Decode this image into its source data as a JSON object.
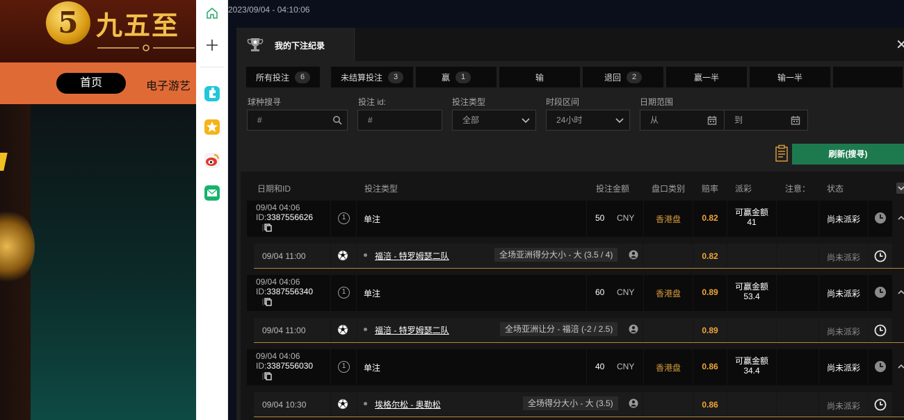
{
  "background_site": {
    "logo_glyph": "5",
    "logo_text": "九五至",
    "nav_home": "首页",
    "nav_games": "电子游艺"
  },
  "window": {
    "timestamp": "2023/09/04 - 04:10:06"
  },
  "modal": {
    "title": "我的下注纪录",
    "close_glyph": "✕",
    "tabs": [
      {
        "label": "所有投注",
        "count": "6"
      },
      {
        "label": "未结算投注",
        "count": "3"
      },
      {
        "label": "赢",
        "count": "1"
      },
      {
        "label": "输",
        "count": ""
      },
      {
        "label": "退回",
        "count": "2"
      },
      {
        "label": "赢一半",
        "count": ""
      },
      {
        "label": "输一半",
        "count": ""
      }
    ],
    "filters": {
      "sport_search": {
        "label": "球种搜寻",
        "placeholder": "#"
      },
      "bet_id": {
        "label": "投注 id:",
        "placeholder": "#"
      },
      "bet_type": {
        "label": "投注类型",
        "value": "全部"
      },
      "time_range": {
        "label": "时段区间",
        "value": "24小时"
      },
      "date_range": {
        "label": "日期范围",
        "from": "从",
        "to": "到"
      }
    },
    "refresh_label": "刷新(搜寻)",
    "columns": {
      "date_id": "日期和ID",
      "bet_type": "投注类型",
      "amount": "投注金额",
      "market": "盘口类别",
      "odds": "赔率",
      "payout": "派彩",
      "note": "注意：",
      "status": "状态"
    },
    "bets": [
      {
        "date": "09/04 04:06",
        "id_prefix": "ID:",
        "id": "3387556626",
        "legs": "1",
        "type": "单注",
        "amount": "50",
        "currency": "CNY",
        "market": "香港盘",
        "odds": "0.82",
        "payout_label": "可赢金额",
        "payout": "41",
        "status": "尚未派彩",
        "sub": {
          "time": "09/04 11:00",
          "match": "福涪 - 特罗姆瑟二队",
          "selection": "全场亚洲得分大小 - 大 (3.5 / 4)",
          "odds": "0.82",
          "status": "尚未派彩"
        }
      },
      {
        "date": "09/04 04:06",
        "id_prefix": "ID:",
        "id": "3387556340",
        "legs": "1",
        "type": "单注",
        "amount": "60",
        "currency": "CNY",
        "market": "香港盘",
        "odds": "0.89",
        "payout_label": "可赢金额",
        "payout": "53.4",
        "status": "尚未派彩",
        "sub": {
          "time": "09/04 11:00",
          "match": "福涪 - 特罗姆瑟二队",
          "selection": "全场亚洲让分 - 福涪 (-2 / 2.5)",
          "odds": "0.89",
          "status": "尚未派彩"
        }
      },
      {
        "date": "09/04 04:06",
        "id_prefix": "ID:",
        "id": "3387556030",
        "legs": "1",
        "type": "单注",
        "amount": "40",
        "currency": "CNY",
        "market": "香港盘",
        "odds": "0.86",
        "payout_label": "可赢金额",
        "payout": "34.4",
        "status": "尚未派彩",
        "sub": {
          "time": "09/04 10:30",
          "match": "埃格尔松 - 奥勒松",
          "selection": "全场得分大小 - 大 (3.5)",
          "odds": "0.86",
          "status": "尚未派彩"
        }
      }
    ]
  },
  "colors": {
    "accent_green": "#1d7a4f",
    "odds_orange": "#f0a43a",
    "market_gold": "#d39a3a",
    "nav_orange": "#e06a36"
  },
  "icons": [
    "home-icon",
    "plus-icon",
    "puzzle-icon",
    "star-icon",
    "weibo-icon",
    "mail-icon",
    "trophy-icon",
    "search-icon",
    "calendar-icon",
    "chevron-down-icon",
    "copy-icon",
    "clock-icon",
    "soccer-ball-icon",
    "person-icon",
    "print-icon",
    "close-icon"
  ]
}
